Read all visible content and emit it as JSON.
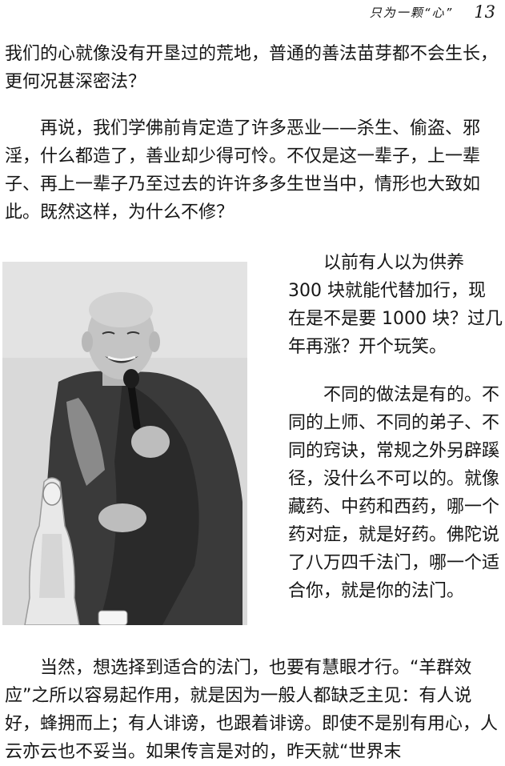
{
  "header": {
    "running_title": "只为一颗“心”",
    "page_number": "13"
  },
  "paragraphs": {
    "p1": "我们的心就像没有开垦过的荒地，普通的善法苗芽都不会生长，更何况甚深密法？",
    "p2": "再说，我们学佛前肯定造了许多恶业——杀生、偷盗、邪淫，什么都造了，善业却少得可怜。不仅是这一辈子，上一辈子、再上一辈子乃至过去的许许多多生世当中，情形也大致如此。既然这样，为什么不修？",
    "p3": "以前有人以为供养 300 块就能代替加行，现在是不是要 1000 块？过几年再涨？开个玩笑。",
    "p4": "不同的做法是有的。不同的上师、不同的弟子、不同的窍诀，常规之外另辟蹊径，没什么不可以的。就像藏药、中药和西药，哪一个药对症，就是好药。佛陀说了八万四千法门，哪一个适合你，就是你的法门。",
    "p5": "当然，想选择到适合的法门，也要有慧眼才行。“羊群效应”之所以容易起作用，就是因为一般人都缺乏主见：有人说好，蜂拥而上；有人诽谤，也跟着诽谤。即使不是别有用心，人云亦云也不妥当。如果传言是对的，昨天就“世界末"
  }
}
